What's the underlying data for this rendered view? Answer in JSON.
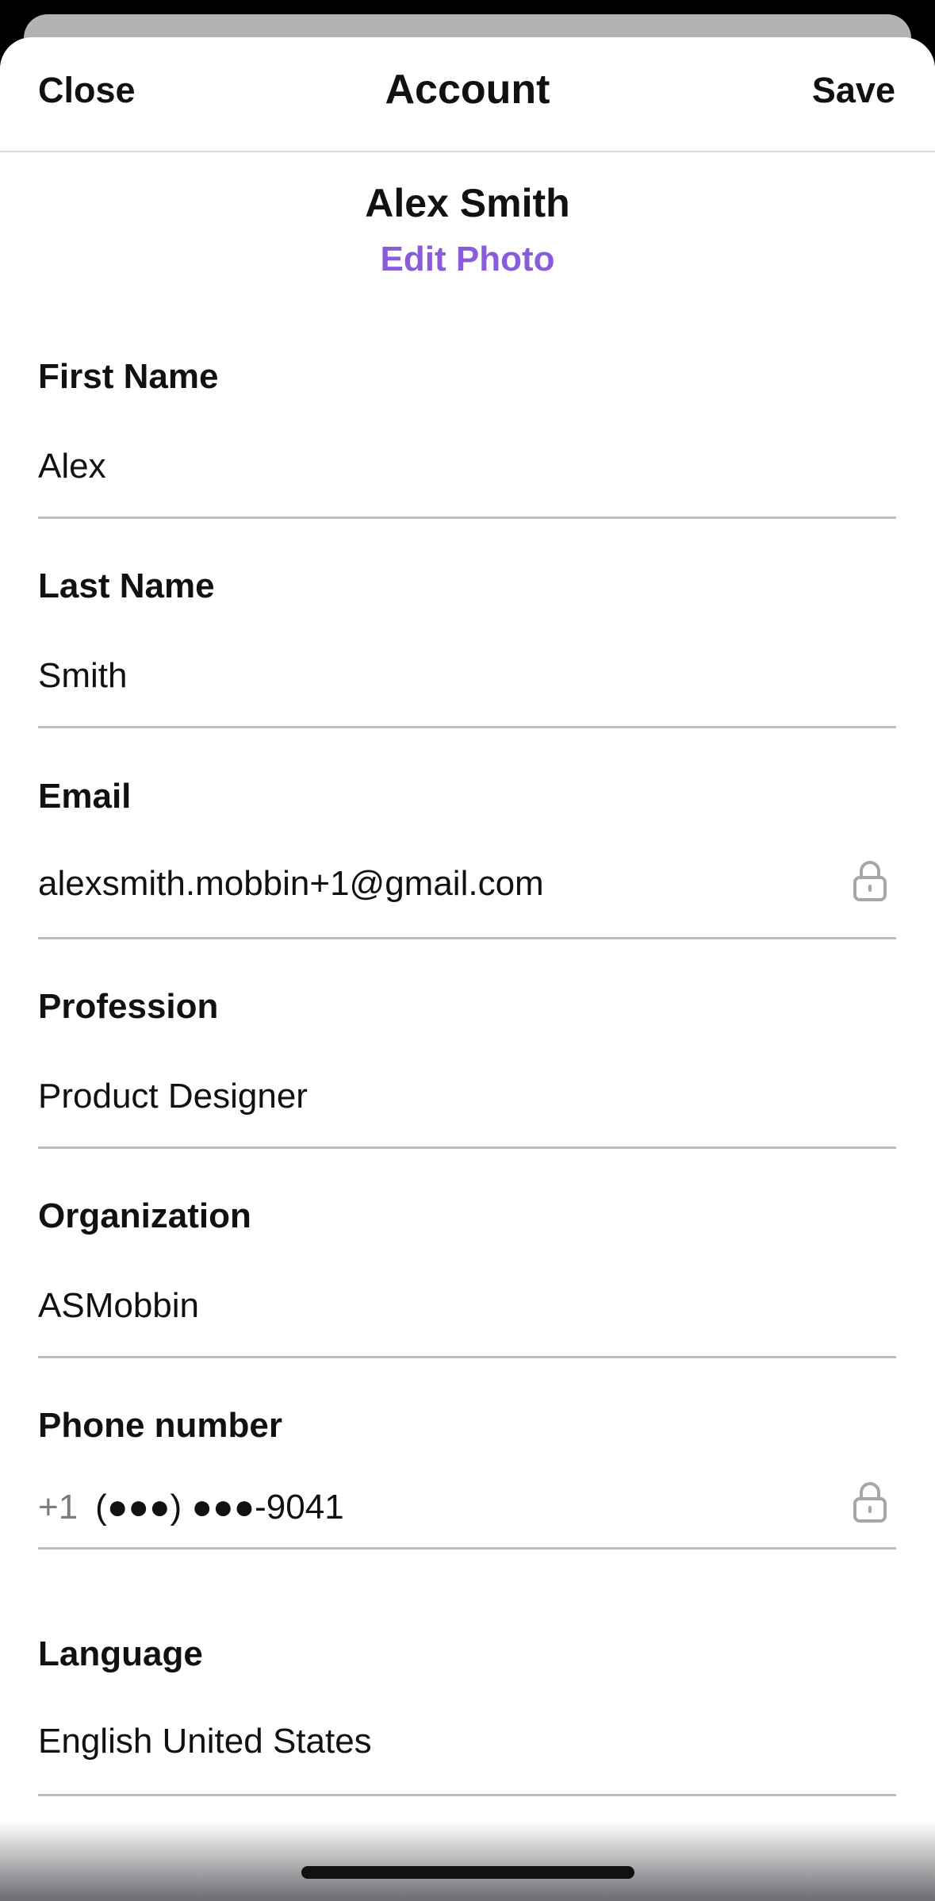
{
  "header": {
    "close_label": "Close",
    "title": "Account",
    "save_label": "Save"
  },
  "profile": {
    "name": "Alex Smith",
    "edit_photo_label": "Edit Photo"
  },
  "fields": {
    "first_name": {
      "label": "First Name",
      "value": "Alex"
    },
    "last_name": {
      "label": "Last Name",
      "value": "Smith"
    },
    "email": {
      "label": "Email",
      "value": "alexsmith.mobbin+1@gmail.com",
      "icon": "lock-icon"
    },
    "profession": {
      "label": "Profession",
      "value": "Product Designer"
    },
    "organization": {
      "label": "Organization",
      "value": "ASMobbin"
    },
    "phone": {
      "label": "Phone number",
      "prefix": "+1",
      "value": "(●●●) ●●●-9041",
      "icon": "lock-icon"
    },
    "language": {
      "label": "Language",
      "value": "English United States"
    }
  },
  "colors": {
    "accent": "#8a5cdb",
    "divider": "#bdbdc2",
    "muted": "#7b7b80"
  }
}
